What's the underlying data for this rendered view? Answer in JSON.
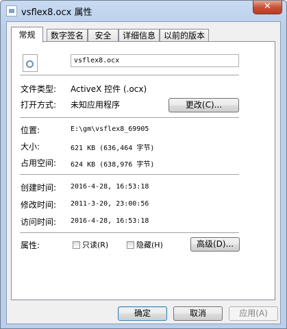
{
  "window": {
    "title": "vsflex8.ocx 属性",
    "close_glyph": "✕"
  },
  "tabs": [
    {
      "label": "常规"
    },
    {
      "label": "数字签名"
    },
    {
      "label": "安全"
    },
    {
      "label": "详细信息"
    },
    {
      "label": "以前的版本"
    }
  ],
  "general": {
    "file_name": "vsflex8.ocx",
    "file_type_label": "文件类型:",
    "file_type_value": "ActiveX 控件 (.ocx)",
    "open_with_label": "打开方式:",
    "open_with_value": "未知应用程序",
    "change_button": "更改(C)...",
    "location_label": "位置:",
    "location_value": "E:\\gm\\vsflex8_69905",
    "size_label": "大小:",
    "size_value": "621 KB (636,464 字节)",
    "size_on_disk_label": "占用空间:",
    "size_on_disk_value": "624 KB (638,976 字节)",
    "created_label": "创建时间:",
    "created_value": "2016-4-28, 16:53:18",
    "modified_label": "修改时间:",
    "modified_value": "2011-3-20, 23:00:56",
    "accessed_label": "访问时间:",
    "accessed_value": "2016-4-28, 16:53:18",
    "attributes_label": "属性:",
    "readonly_label": "只读(R)",
    "hidden_label": "隐藏(H)",
    "advanced_button": "高级(D)..."
  },
  "footer": {
    "ok": "确定",
    "cancel": "取消",
    "apply": "应用(A)"
  }
}
